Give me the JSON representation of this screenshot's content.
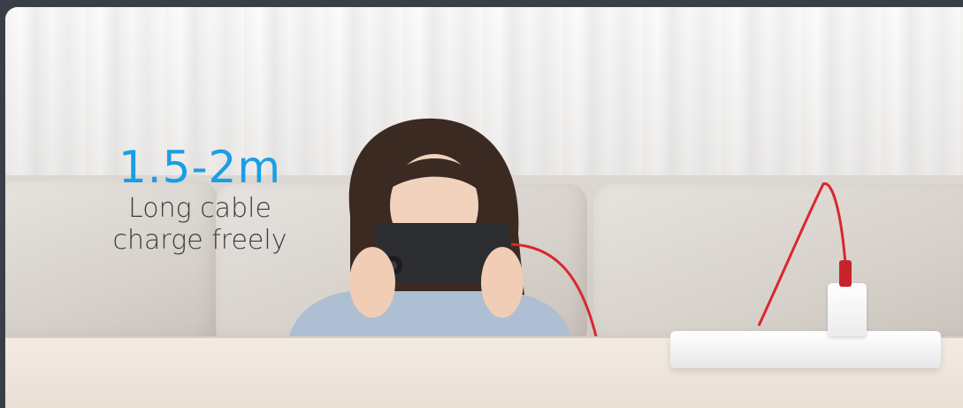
{
  "headline": {
    "value": "1.5-2m",
    "line1": "Long cable",
    "line2": "charge freely"
  },
  "colors": {
    "accent": "#1a9ee6",
    "cable": "#d9272f",
    "text": "#3c3c3c"
  }
}
